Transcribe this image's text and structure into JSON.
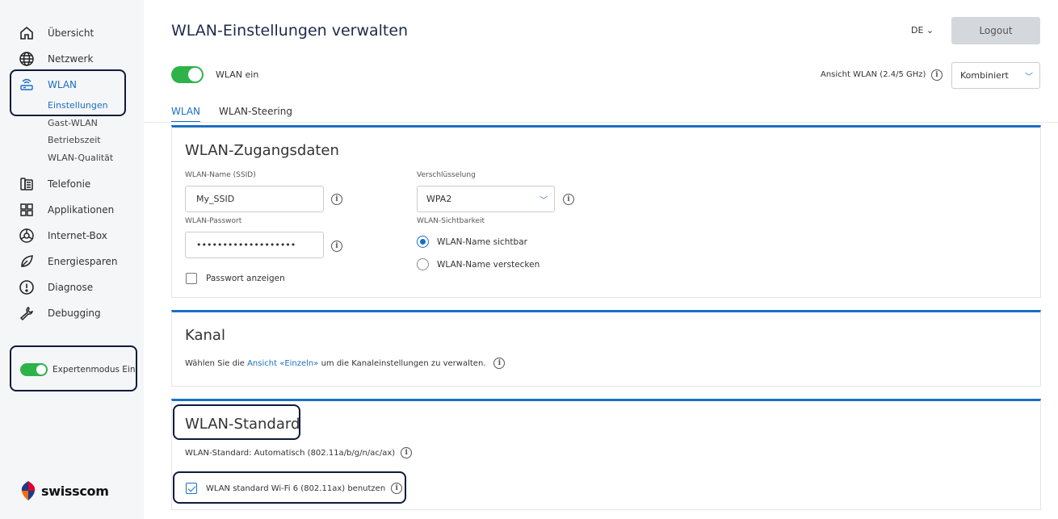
{
  "colors": {
    "accent": "#1a6fc4",
    "toggle_on": "#2db34a",
    "highlight": "#0f1a3c",
    "sidebar_bg": "#f5f6f8"
  },
  "sidebar": {
    "nav": [
      {
        "label": "Übersicht",
        "icon": "home-icon"
      },
      {
        "label": "Netzwerk",
        "icon": "globe-icon"
      },
      {
        "label": "WLAN",
        "icon": "router-icon",
        "active": true
      },
      {
        "label": "Telefonie",
        "icon": "phone-icon"
      },
      {
        "label": "Applikationen",
        "icon": "apps-icon"
      },
      {
        "label": "Internet-Box",
        "icon": "box-icon"
      },
      {
        "label": "Energiesparen",
        "icon": "leaf-icon"
      },
      {
        "label": "Diagnose",
        "icon": "alert-icon"
      },
      {
        "label": "Debugging",
        "icon": "wrench-icon"
      }
    ],
    "wlan_sub": [
      "Einstellungen",
      "Gast-WLAN",
      "Betriebszeit",
      "WLAN-Qualität"
    ],
    "expert_mode": {
      "label": "Expertenmodus Ein",
      "on": true
    },
    "logo_text": "swisscom"
  },
  "header": {
    "title": "WLAN-Einstellungen verwalten",
    "language": "DE",
    "logout_label": "Logout"
  },
  "wlan_toggle": {
    "label": "WLAN ein",
    "on": true
  },
  "view": {
    "label": "Ansicht WLAN (2.4/5 GHz)",
    "selected": "Kombiniert"
  },
  "tabs": [
    {
      "label": "WLAN",
      "active": true
    },
    {
      "label": "WLAN-Steering",
      "active": false
    }
  ],
  "access": {
    "title": "WLAN-Zugangsdaten",
    "ssid_label": "WLAN-Name (SSID)",
    "ssid_value": "My_SSID",
    "password_label": "WLAN-Passwort",
    "password_value": "•••••••••••••••••••",
    "show_password_label": "Passwort anzeigen",
    "encryption_label": "Verschlüsselung",
    "encryption_value": "WPA2",
    "visibility_label": "WLAN-Sichtbarkeit",
    "visible_label": "WLAN-Name sichtbar",
    "hidden_label": "WLAN-Name verstecken"
  },
  "channel": {
    "title": "Kanal",
    "text_before": "Wählen Sie die",
    "link": "Ansicht «Einzeln»",
    "text_after": "um die Kanaleinstellungen zu verwalten."
  },
  "standard": {
    "title": "WLAN-Standard",
    "info_text": "WLAN-Standard: Automatisch (802.11a/b/g/n/ac/ax)",
    "wifi6_label": "WLAN standard Wi-Fi 6 (802.11ax) benutzen",
    "wifi6_checked": true
  }
}
